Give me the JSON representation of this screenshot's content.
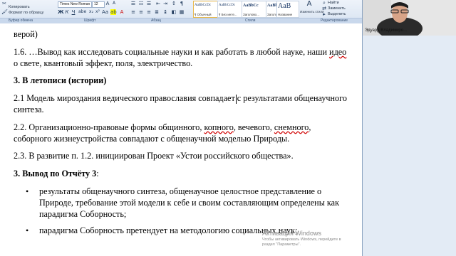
{
  "ribbon": {
    "clipboard": {
      "copy_label": "Копировать",
      "format_label": "Формат по образцу",
      "group_label": "Буфер обмена"
    },
    "font": {
      "font_name": "Times New Roman",
      "font_size": "12",
      "group_label": "Шрифт"
    },
    "paragraph": {
      "group_label": "Абзац"
    },
    "styles": {
      "group_label": "Стили",
      "items": [
        {
          "sample": "AaBbCcDc",
          "name": "¶ Обычный"
        },
        {
          "sample": "AaBbCcDc",
          "name": "¶ Без инте..."
        },
        {
          "sample": "AaBbCc",
          "name": "Заголово..."
        },
        {
          "sample": "AaBbCc",
          "name": "Заголово..."
        },
        {
          "sample": "AaB",
          "name": "Название"
        }
      ],
      "change_label": "Изменить стили"
    },
    "editing": {
      "find_label": "Найти",
      "replace_label": "Заменить",
      "select_label": "Выделить",
      "group_label": "Редактирование"
    }
  },
  "document": {
    "line0": "верой)",
    "p1_a": "1.6. …Вывод как исследовать социальные науки и как работать в любой науке, наши ",
    "p1_b": "идео",
    "p1_c": "о свете, квантовый эффект, поля, электричество.",
    "h3": "3. В летописи (истории)",
    "p21_a": "2.1 Модель мироздания ведического православия совпадает",
    "p21_b": "с результатами общенаучного",
    "p21_c": "синтеза.",
    "p22_a": "2.2. Организационно-правовые формы общинного, ",
    "p22_b": "копного",
    "p22_c": ", вечевого, ",
    "p22_d": "снемного",
    "p22_e": ",",
    "p22_f": "соборного жизнеустройства совпадают с общенаучной моделью Природы.",
    "p23": "2.3. В развитие п. 1.2. инициирован Проект «Устои российского общества».",
    "h4_bold": "3. Вывод по Отчёту 3",
    "h4_colon": ":",
    "b1_l1": "результаты общенаучного синтеза, общенаучное целостное представление о",
    "b1_l2": "Природе, требование этой модели к себе и своим составляющим определены как",
    "b1_l3": "парадигма Соборность;",
    "b2_l1": "парадигма Соборность претендует на методологию социальных наук;",
    "bullet_glyph": "•"
  },
  "video": {
    "participant_name": "Эдуард Владимиро..."
  },
  "watermark": {
    "title": "Активация Windows",
    "line1": "Чтобы активировать Windows, перейдите в",
    "line2": "раздел \"Параметры\"."
  },
  "colors": {
    "ribbon_bg": "#dbe5f2",
    "panel_bg": "#e3ebf5",
    "spell_underline": "#d00000"
  }
}
